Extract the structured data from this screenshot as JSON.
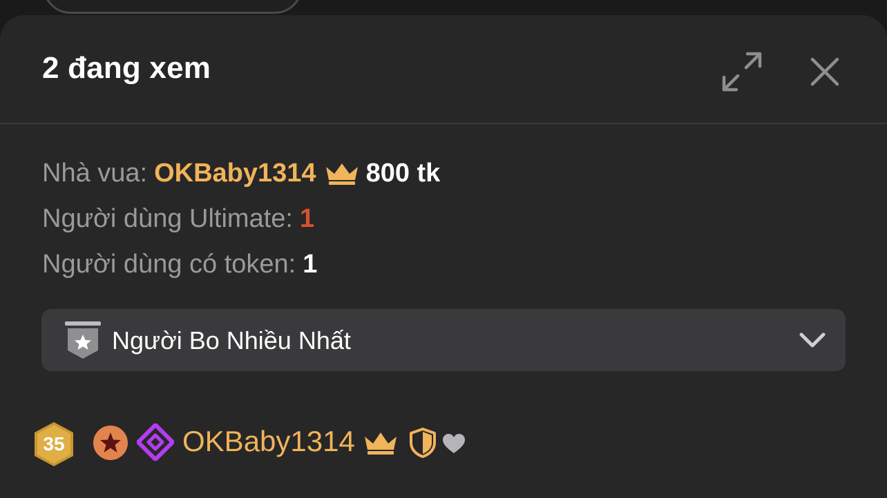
{
  "header": {
    "title": "2 đang xem"
  },
  "stats": {
    "king_label": "Nhà vua:",
    "king_name": "OKBaby1314",
    "king_tokens": "800 tk",
    "ultimate_label": "Người dùng Ultimate:",
    "ultimate_count": "1",
    "token_users_label": "Người dùng có token:",
    "token_users_count": "1"
  },
  "dropdown": {
    "label": "Người Bo Nhiều Nhất",
    "icon": "star-shield-icon"
  },
  "users": [
    {
      "level": "35",
      "name": "OKBaby1314"
    }
  ],
  "colors": {
    "background": "#272728",
    "gold": "#f0b45a",
    "ultimate": "#d8522e",
    "diamond": "#b43cf0",
    "dropdown_bg": "#3a3a3c"
  }
}
